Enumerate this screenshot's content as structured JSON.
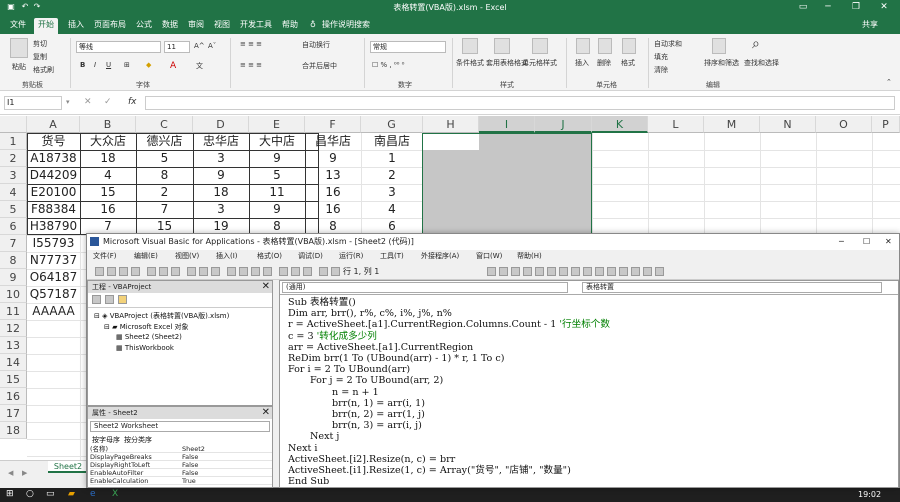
{
  "excel": {
    "title": "表格转置(VBA版).xlsm  -  Excel",
    "tabs": [
      "文件",
      "开始",
      "插入",
      "页面布局",
      "公式",
      "数据",
      "审阅",
      "视图",
      "开发工具",
      "帮助"
    ],
    "active_tab": "开始",
    "tell_me": "操作说明搜索",
    "share": "共享",
    "ribbon": {
      "clipboard": {
        "label": "剪贴板",
        "paste": "粘贴",
        "cut": "剪切",
        "copy": "复制",
        "format_painter": "格式刷"
      },
      "font": {
        "label": "字体",
        "name": "等线",
        "size": "11"
      },
      "align": {
        "wrap": "自动换行",
        "merge": "合并后居中"
      },
      "number": {
        "label": "数字",
        "format": "常规"
      },
      "styles": {
        "label": "样式",
        "cond": "条件格式",
        "table": "套用表格格式",
        "cell": "单元格样式"
      },
      "cells": {
        "label": "单元格",
        "insert": "插入",
        "delete": "删除",
        "format": "格式"
      },
      "editing": {
        "label": "编辑",
        "autosum": "自动求和",
        "fill": "填充",
        "clear": "清除",
        "sort": "排序和筛选",
        "find": "查找和选择"
      }
    },
    "name_box": "I1",
    "formula_fx": "fx",
    "columns": [
      "A",
      "B",
      "C",
      "D",
      "E",
      "F",
      "G",
      "H",
      "I",
      "J",
      "K",
      "L",
      "M",
      "N",
      "O",
      "P"
    ],
    "rows": [
      "1",
      "2",
      "3",
      "4",
      "5",
      "6",
      "7",
      "8",
      "9",
      "10",
      "11",
      "12",
      "13",
      "14",
      "15",
      "16",
      "17",
      "18"
    ],
    "headers": [
      "货号",
      "大众店",
      "德兴店",
      "忠华店",
      "大中店",
      "昌华店",
      "南昌店"
    ],
    "data": [
      [
        "A18738",
        "18",
        "5",
        "3",
        "9",
        "9",
        "1"
      ],
      [
        "D44209",
        "4",
        "8",
        "9",
        "5",
        "13",
        "2"
      ],
      [
        "E20100",
        "15",
        "2",
        "18",
        "11",
        "16",
        "3"
      ],
      [
        "F88384",
        "16",
        "7",
        "3",
        "9",
        "16",
        "4"
      ],
      [
        "H38790",
        "7",
        "15",
        "19",
        "8",
        "8",
        "6"
      ]
    ],
    "col_a_extra": [
      "I55793",
      "N77737",
      "O64187",
      "Q57187",
      "AAAAA"
    ],
    "sheet_tab": "Sheet2",
    "clock": "19:02"
  },
  "vbe": {
    "title": "Microsoft Visual Basic for Applications - 表格转置(VBA版).xlsm - [Sheet2 (代码)]",
    "menu": [
      "文件(F)",
      "编辑(E)",
      "视图(V)",
      "插入(I)",
      "格式(O)",
      "调试(D)",
      "运行(R)",
      "工具(T)",
      "外接程序(A)",
      "窗口(W)",
      "帮助(H)"
    ],
    "position": "行 1, 列 1",
    "project_title": "工程 - VBAProject",
    "tree": [
      "VBAProject (表格转置(VBA版).xlsm)",
      "Microsoft Excel 对象",
      "Sheet2 (Sheet2)",
      "ThisWorkbook"
    ],
    "props_title": "属性 - Sheet2",
    "props_combo": "Sheet2 Worksheet",
    "props_tabs": [
      "按字母序",
      "按分类序"
    ],
    "props": [
      [
        "(名称)",
        "Sheet2"
      ],
      [
        "DisplayPageBreaks",
        "False"
      ],
      [
        "DisplayRightToLeft",
        "False"
      ],
      [
        "EnableAutoFilter",
        "False"
      ],
      [
        "EnableCalculation",
        "True"
      ]
    ],
    "combo_left": "(通用)",
    "combo_right": "表格转置",
    "code": [
      {
        "t": "Sub 表格转置()",
        "i": 0
      },
      {
        "t": "Dim arr, brr(), r%, c%, i%, j%, n%",
        "i": 0
      },
      {
        "t": "r = ActiveSheet.[a1].CurrentRegion.Columns.Count - 1",
        "c": "'行坐标个数",
        "i": 0
      },
      {
        "t": "c = 3",
        "c": "'转化成多少列",
        "i": 0
      },
      {
        "t": "arr = ActiveSheet.[a1].CurrentRegion",
        "i": 0
      },
      {
        "t": "ReDim brr(1 To (UBound(arr) - 1) * r, 1 To c)",
        "i": 0
      },
      {
        "t": "For i = 2 To UBound(arr)",
        "i": 0
      },
      {
        "t": "For j = 2 To UBound(arr, 2)",
        "i": 1
      },
      {
        "t": "n = n + 1",
        "i": 2
      },
      {
        "t": "brr(n, 1) = arr(i, 1)",
        "i": 2
      },
      {
        "t": "brr(n, 2) = arr(1, j)",
        "i": 2
      },
      {
        "t": "brr(n, 3) = arr(i, j)",
        "i": 2
      },
      {
        "t": "Next j",
        "i": 1
      },
      {
        "t": "Next i",
        "i": 0
      },
      {
        "t": "ActiveSheet.[i2].Resize(n, c) = brr",
        "i": 0
      },
      {
        "t": "ActiveSheet.[i1].Resize(1, c) = Array(\"货号\", \"店铺\", \"数量\")",
        "i": 0
      },
      {
        "t": "End Sub",
        "i": 0
      }
    ]
  }
}
